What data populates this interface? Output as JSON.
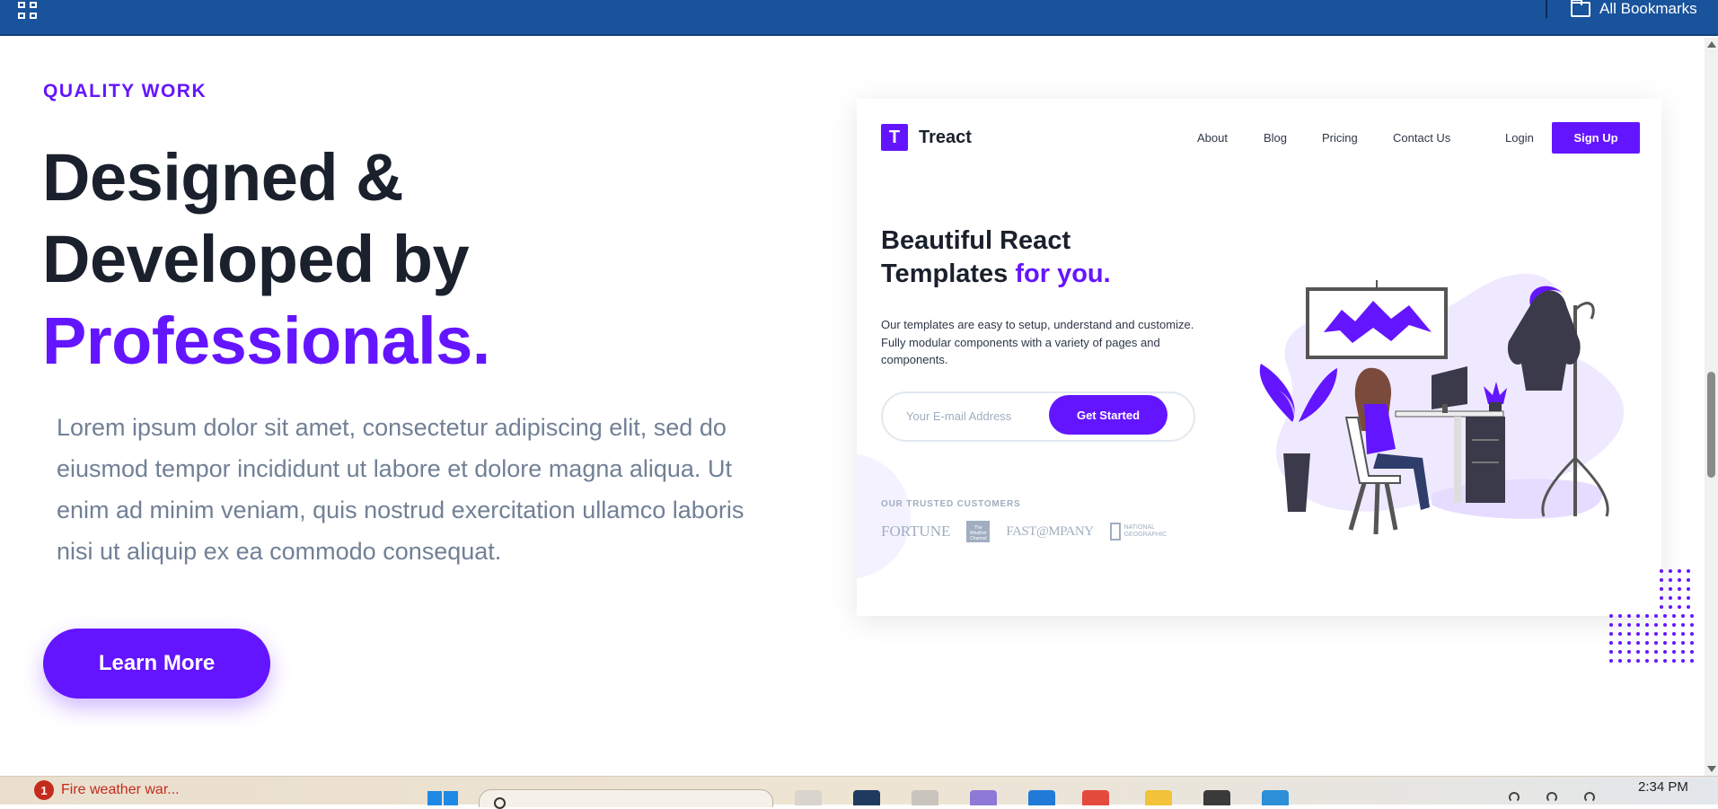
{
  "browser": {
    "apps_icon": "apps-grid-icon",
    "bookmarks_folder_icon": "folder-icon",
    "bookmarks_label": "All Bookmarks"
  },
  "hero": {
    "subheading": "QUALITY WORK",
    "headline_line1": "Designed &",
    "headline_line2": "Developed by",
    "headline_accent": "Professionals.",
    "description": "Lorem ipsum dolor sit amet, consectetur adipiscing elit, sed do eiusmod tempor incididunt ut labore et dolore magna aliqua. Ut enim ad minim veniam, quis nostrud exercitation ullamco laboris nisi ut aliquip ex ea commodo consequat.",
    "button_label": "Learn More"
  },
  "preview": {
    "logo_mark": "T",
    "logo_text": "Treact",
    "nav": [
      "About",
      "Blog",
      "Pricing",
      "Contact Us",
      "Login"
    ],
    "signup_label": "Sign Up",
    "title_line1": "Beautiful React",
    "title_line2": "Templates",
    "title_accent": "for you.",
    "text": "Our templates are easy to setup, understand and customize. Fully modular components with a variety of pages and components.",
    "email_placeholder": "Your E-mail Address",
    "cta_label": "Get Started",
    "trusted_label": "OUR TRUSTED CUSTOMERS",
    "trusted_logos": {
      "fortune": "FORTUNE",
      "weather_line1": "The",
      "weather_line2": "Weather",
      "weather_line3": "Channel",
      "fastcompany": "FAST@MPANY",
      "natgeo_line1": "NATIONAL",
      "natgeo_line2": "GEOGRAPHIC"
    }
  },
  "taskbar": {
    "weather_badge": "1",
    "weather_text": "Fire weather war...",
    "clock": "2:34 PM"
  },
  "colors": {
    "accent": "#6415ff",
    "bookmark_bar": "#19539b",
    "heading": "#1a202c",
    "body_text": "#718096"
  }
}
